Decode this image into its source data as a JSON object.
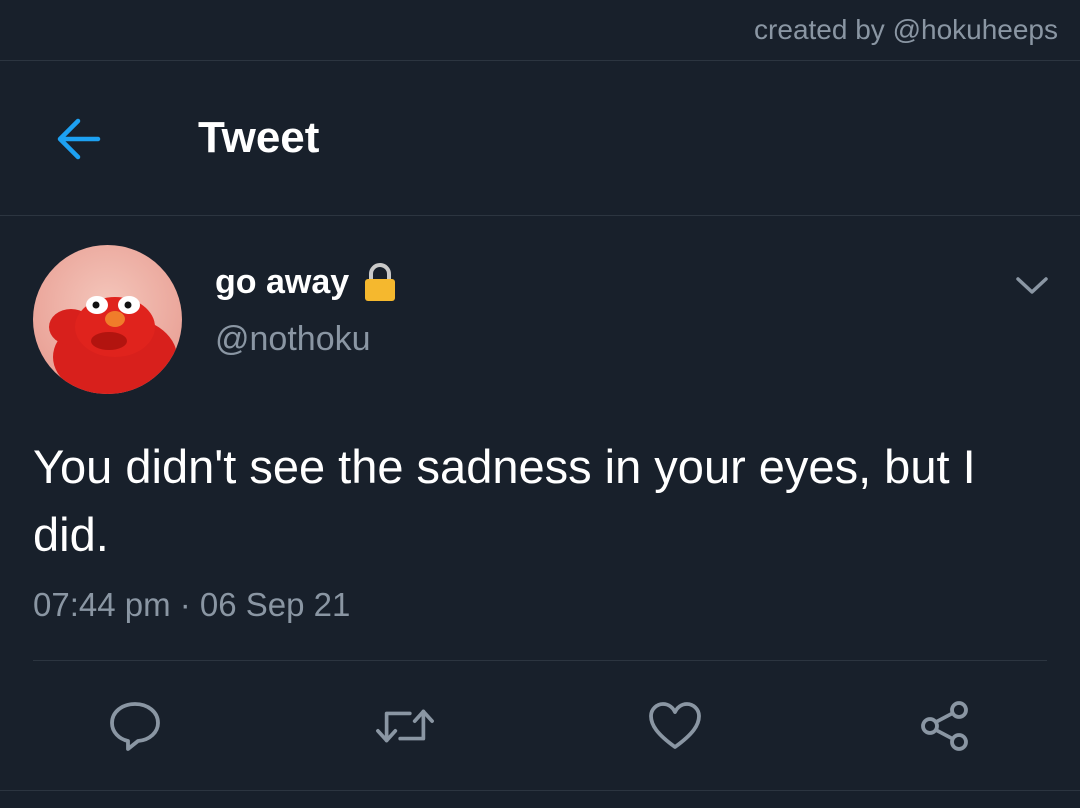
{
  "credit": "created by @hokuheeps",
  "header": {
    "back_icon": "arrow-left-icon",
    "title": "Tweet"
  },
  "tweet": {
    "author": {
      "display_name": "go away",
      "handle": "@nothoku",
      "protected_icon": "lock-icon",
      "avatar": "avatar-image"
    },
    "menu_icon": "chevron-down-icon",
    "text": "You didn't see the sadness in your eyes, but I did.",
    "timestamp": "07:44 pm · 06 Sep 21",
    "actions": [
      {
        "name": "reply",
        "icon": "speech-bubble-icon"
      },
      {
        "name": "retweet",
        "icon": "retweet-icon"
      },
      {
        "name": "like",
        "icon": "heart-icon"
      },
      {
        "name": "share",
        "icon": "share-icon"
      }
    ]
  },
  "colors": {
    "background": "#18202b",
    "accent": "#1da1f2",
    "secondary_text": "#8a96a3",
    "divider": "#2c3540",
    "lock": "#f5b82e"
  }
}
